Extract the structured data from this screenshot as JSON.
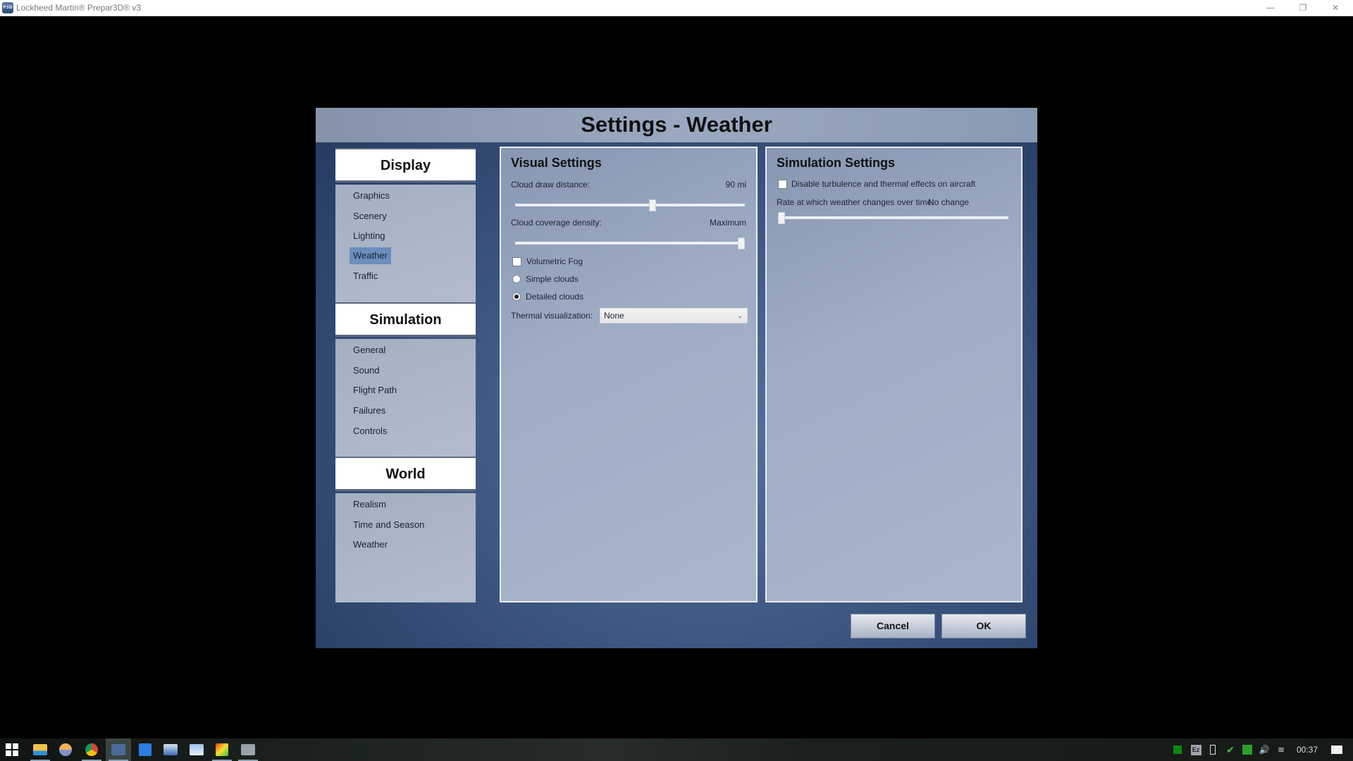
{
  "window": {
    "title": "Lockheed Martin® Prepar3D® v3",
    "app_icon_text": "P3D",
    "minimize_icon": "minimize-icon",
    "restore_icon": "restore-icon",
    "close_icon": "close-icon"
  },
  "dialog": {
    "title": "Settings - Weather",
    "sidebar": {
      "sections": [
        {
          "header": "Display",
          "items": [
            {
              "label": "Graphics",
              "selected": false
            },
            {
              "label": "Scenery",
              "selected": false
            },
            {
              "label": "Lighting",
              "selected": false
            },
            {
              "label": "Weather",
              "selected": true
            },
            {
              "label": "Traffic",
              "selected": false
            }
          ]
        },
        {
          "header": "Simulation",
          "items": [
            {
              "label": "General",
              "selected": false
            },
            {
              "label": "Sound",
              "selected": false
            },
            {
              "label": "Flight Path",
              "selected": false
            },
            {
              "label": "Failures",
              "selected": false
            },
            {
              "label": "Controls",
              "selected": false
            }
          ]
        },
        {
          "header": "World",
          "items": [
            {
              "label": "Realism",
              "selected": false
            },
            {
              "label": "Time and Season",
              "selected": false
            },
            {
              "label": "Weather",
              "selected": false
            }
          ]
        }
      ]
    },
    "visual_settings": {
      "title": "Visual Settings",
      "cloud_draw_distance": {
        "label": "Cloud draw distance:",
        "value_text": "90 mi",
        "slider_fraction": 0.6
      },
      "cloud_coverage_density": {
        "label": "Cloud coverage density:",
        "value_text": "Maximum",
        "slider_fraction": 1.0
      },
      "volumetric_fog": {
        "label": "Volumetric Fog",
        "checked": false
      },
      "cloud_mode": {
        "options": [
          {
            "label": "Simple clouds",
            "selected": false
          },
          {
            "label": "Detailed clouds",
            "selected": true
          }
        ]
      },
      "thermal_visualization": {
        "label": "Thermal visualization:",
        "value": "None"
      }
    },
    "simulation_settings": {
      "title": "Simulation Settings",
      "disable_turbulence": {
        "label": "Disable turbulence and thermal effects on aircraft",
        "checked": false
      },
      "weather_change_rate": {
        "label": "Rate at which weather changes over time:",
        "value_text": "No change",
        "slider_fraction": 0.0
      }
    },
    "buttons": {
      "cancel": "Cancel",
      "ok": "OK"
    }
  },
  "taskbar": {
    "pinned": [
      {
        "name": "start-icon",
        "color": "#ffffff"
      },
      {
        "name": "file-explorer-icon",
        "color": "#f3c34a"
      },
      {
        "name": "browser-icon",
        "color": "#e9a45a"
      },
      {
        "name": "chrome-icon",
        "color": "#4caf50"
      },
      {
        "name": "prepar3d-icon",
        "color": "#4a6a9a",
        "active": true
      },
      {
        "name": "flight-app-icon",
        "color": "#2b7de0"
      },
      {
        "name": "aircraft-tool-icon",
        "color": "#5a8ac0"
      },
      {
        "name": "opus-icon",
        "color": "#6aa0d8"
      },
      {
        "name": "color-tool-icon",
        "color": "#d84a2a"
      },
      {
        "name": "lvla-icon",
        "color": "#9aa3a8"
      }
    ],
    "tray": {
      "clock": "00:37",
      "icons": [
        "green-square-icon",
        "ez-icon",
        "usb-icon",
        "sync-check-icon",
        "network-monitor-icon",
        "volume-icon",
        "wifi-icon",
        "notification-icon"
      ]
    }
  }
}
